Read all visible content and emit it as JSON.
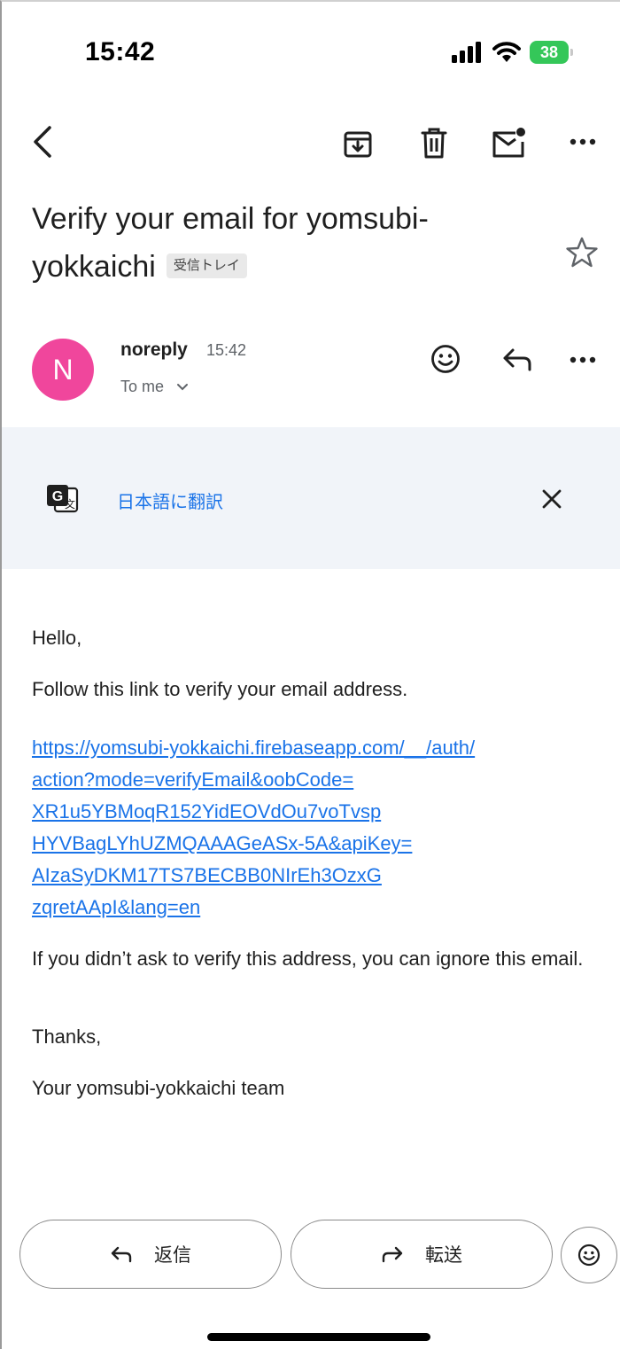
{
  "status_bar": {
    "time": "15:42",
    "battery": "38"
  },
  "email": {
    "subject": "Verify your email for yomsubi-yokkaichi",
    "label": "受信トレイ",
    "sender": "noreply",
    "time": "15:42",
    "recipient": "To me",
    "avatar_letter": "N"
  },
  "translate": {
    "link": "日本語に翻訳"
  },
  "body": {
    "greeting": "Hello,",
    "instruction": "Follow this link to verify your email address.",
    "link_lines": [
      "https://yomsubi-yokkaichi.firebaseapp.com/__/auth/",
      "action?mode=verifyEmail&oobCode=",
      "XR1u5YBMoqR152YidEOVdOu7voTvsp",
      "HYVBagLYhUZMQAAAGeASx-5A&apiKey=",
      "AIzaSyDKM17TS7BECBB0NIrEh3OzxG",
      "zqretAApI&lang=en"
    ],
    "ignore_note": "If you didn’t ask to verify this address, you can ignore this email.",
    "thanks": "Thanks,",
    "signature": "Your yomsubi-yokkaichi team"
  },
  "actions": {
    "reply": "返信",
    "forward": "転送"
  },
  "colors": {
    "link": "#1a73e8",
    "avatar": "#f0469c",
    "battery": "#34c759",
    "translate_bg": "#f1f4f9"
  }
}
